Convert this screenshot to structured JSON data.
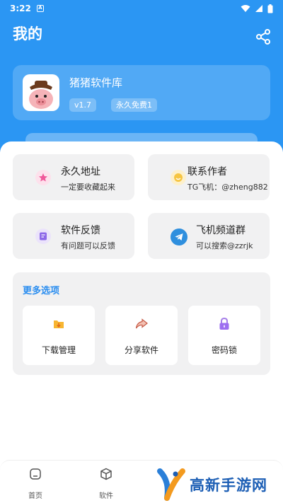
{
  "status_bar": {
    "time": "3:22",
    "notification_icon": "A"
  },
  "header": {
    "title": "我的"
  },
  "profile": {
    "app_name": "猪猪软件库",
    "version": "v1.7",
    "badge": "永久免费1"
  },
  "tiles": [
    {
      "title": "永久地址",
      "subtitle": "一定要收藏起来",
      "icon_color": "#f0589a"
    },
    {
      "title": "联系作者",
      "subtitle": "TG飞机：@zheng882",
      "icon_color": "#f6c542"
    },
    {
      "title": "软件反馈",
      "subtitle": "有问题可以反馈",
      "icon_color": "#8d68e8"
    },
    {
      "title": "飞机频道群",
      "subtitle": "可以搜索@zzrjk",
      "icon_color": "#2f8fde"
    }
  ],
  "more": {
    "title": "更多选项",
    "options": [
      {
        "label": "下载管理"
      },
      {
        "label": "分享软件"
      },
      {
        "label": "密码锁"
      }
    ]
  },
  "nav": {
    "items": [
      {
        "label": "首页"
      },
      {
        "label": "软件"
      }
    ]
  },
  "watermark": {
    "text": "高新手游网"
  },
  "colors": {
    "primary": "#2b96f3",
    "accent": "#2b8ef0"
  }
}
